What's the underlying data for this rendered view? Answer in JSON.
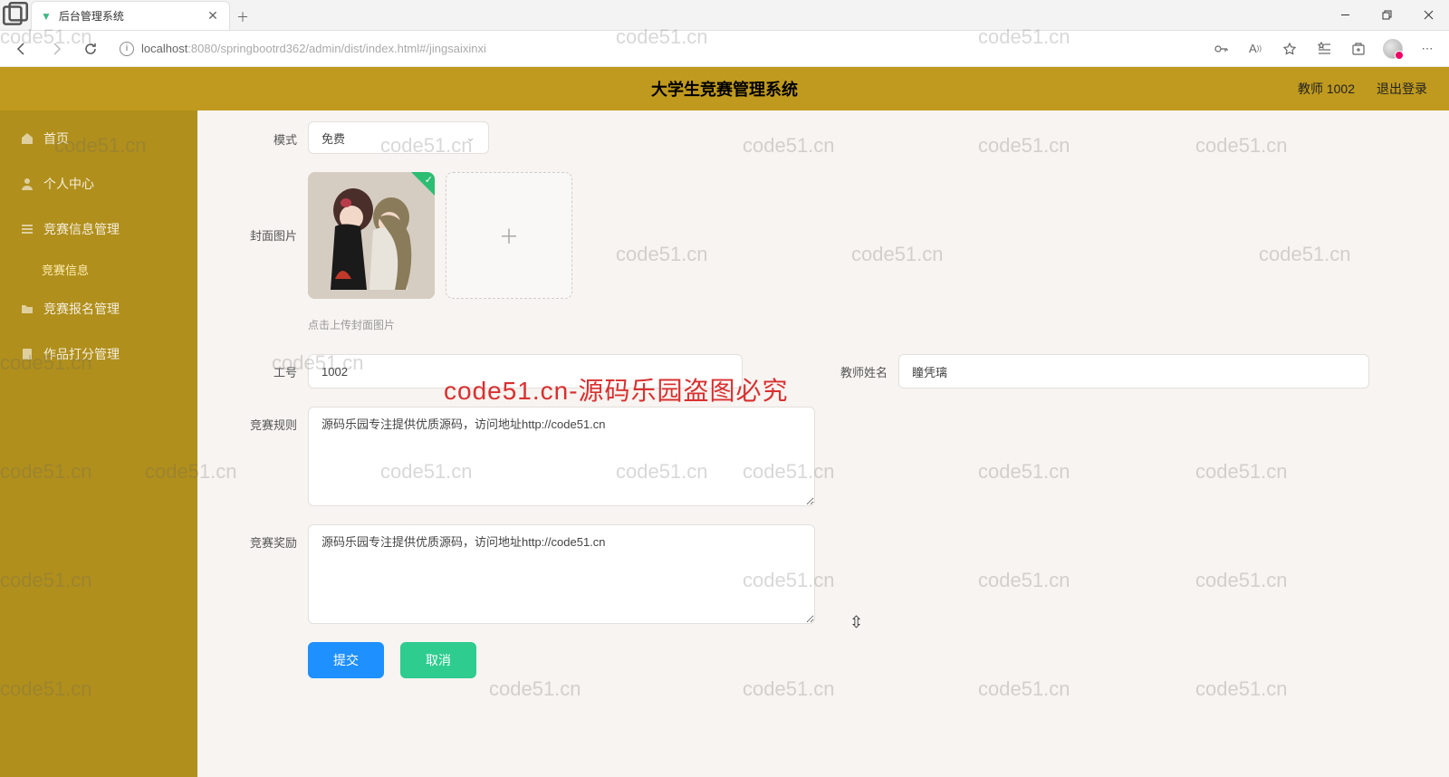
{
  "browser": {
    "tab_title": "后台管理系统",
    "url_host": "localhost",
    "url_port": ":8080",
    "url_path": "/springbootrd362/admin/dist/index.html#/jingsaixinxi"
  },
  "header": {
    "title": "大学生竞赛管理系统",
    "user_label": "教师 1002",
    "logout": "退出登录"
  },
  "sidebar": {
    "home": "首页",
    "personal": "个人中心",
    "comp_info": "竞赛信息管理",
    "comp_info_sub": "竞赛信息",
    "enroll": "竞赛报名管理",
    "scoring": "作品打分管理"
  },
  "form": {
    "mode_label": "模式",
    "mode_value": "免费",
    "cover_label": "封面图片",
    "upload_hint": "点击上传封面图片",
    "worknum_label": "工号",
    "worknum_value": "1002",
    "teacher_label": "教师姓名",
    "teacher_value": "瞳凭璃",
    "rules_label": "竞赛规则",
    "rules_value": "源码乐园专注提供优质源码，访问地址http://code51.cn",
    "reward_label": "竞赛奖励",
    "reward_value": "源码乐园专注提供优质源码，访问地址http://code51.cn",
    "submit": "提交",
    "cancel": "取消"
  },
  "watermark": {
    "gray": "code51.cn",
    "red": "code51.cn-源码乐园盗图必究"
  }
}
